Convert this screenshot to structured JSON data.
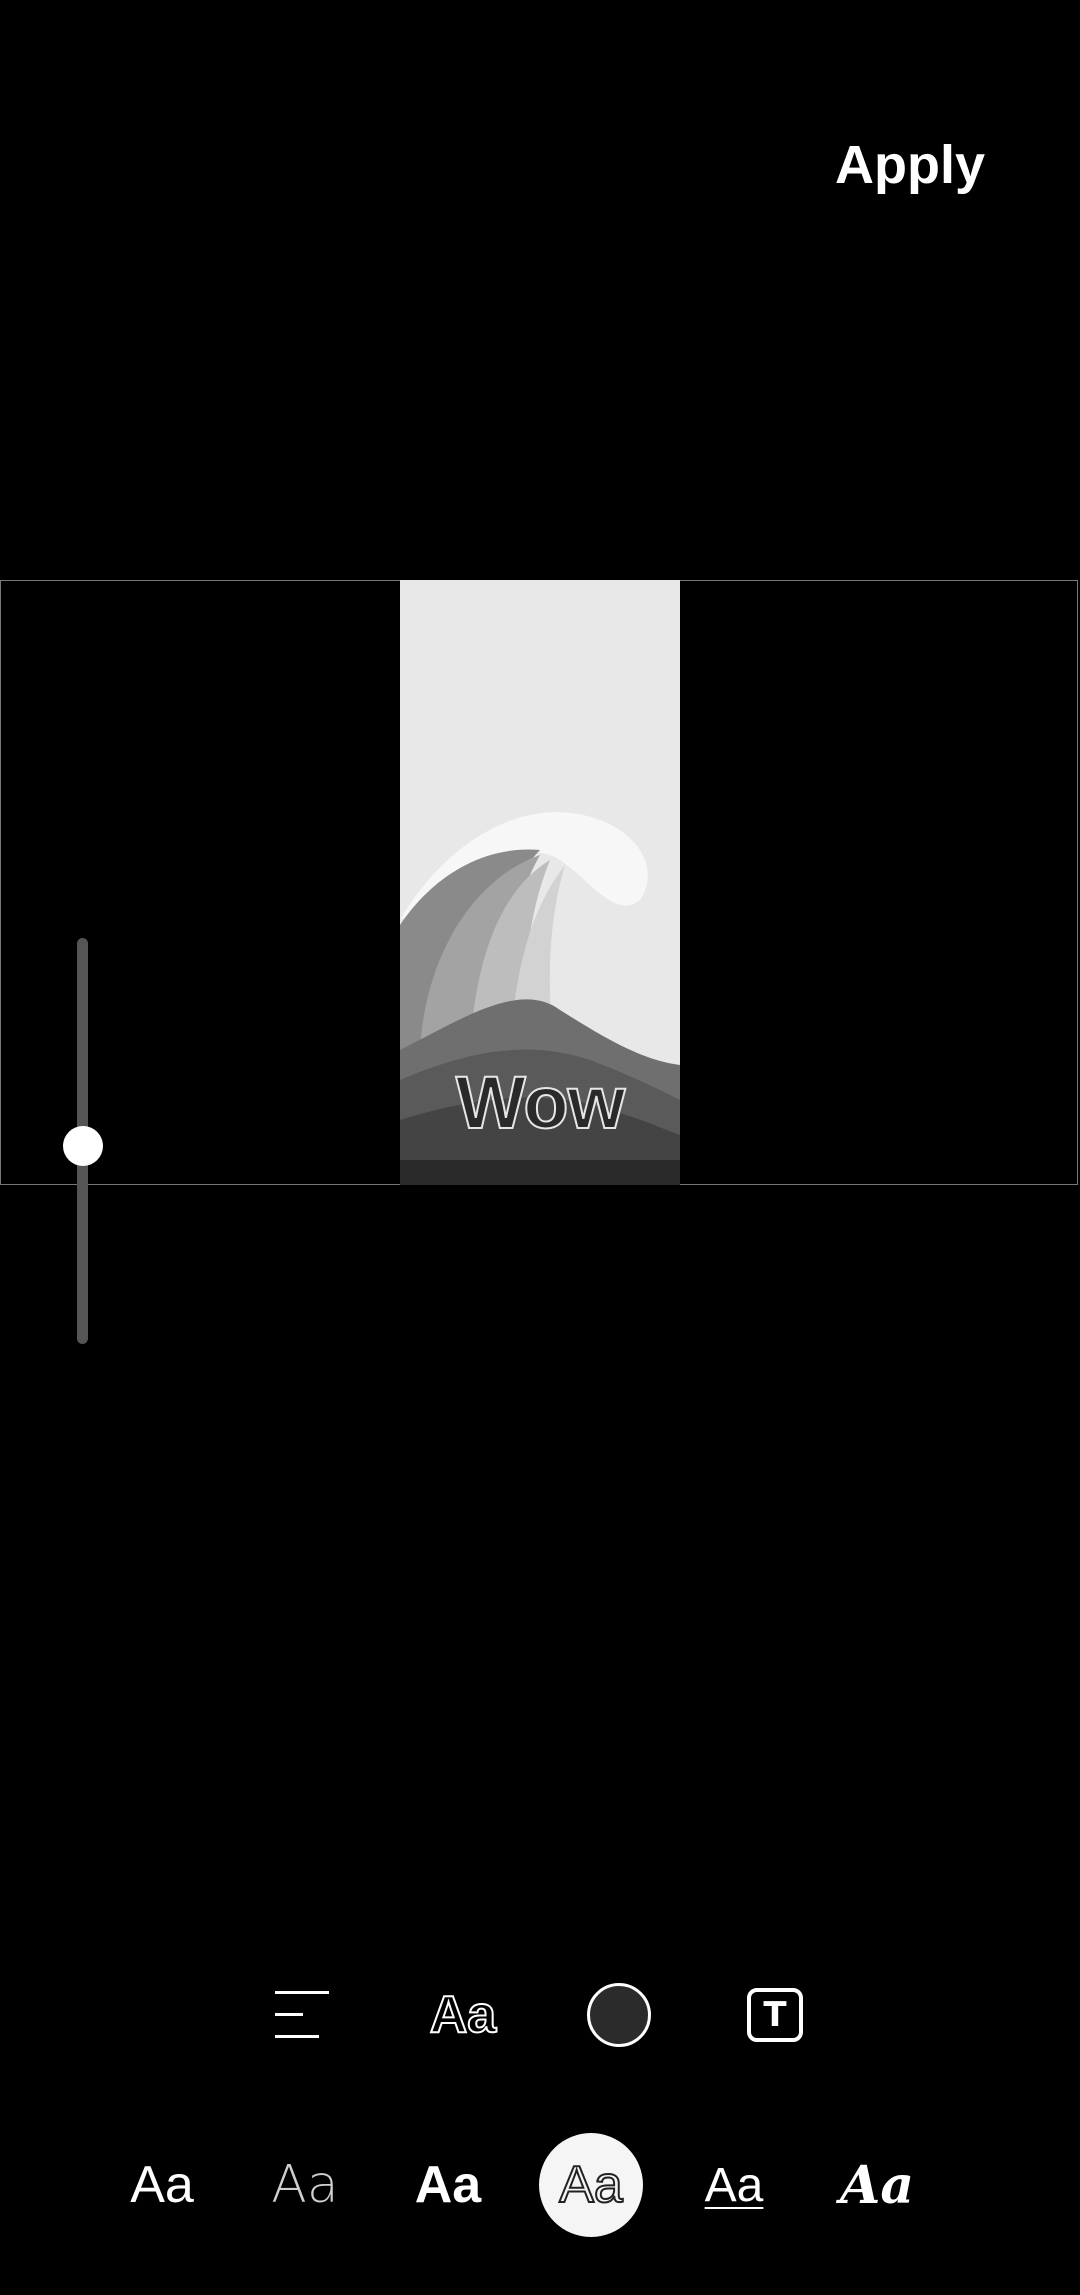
{
  "header": {
    "apply_label": "Apply"
  },
  "preview": {
    "overlay_text": "Wow"
  },
  "toolbar": {
    "tools": [
      {
        "icon": "align-left-icon"
      },
      {
        "icon": "text-outline-style-icon",
        "label": "Aa"
      },
      {
        "icon": "color-circle-icon",
        "color": "#2b2b2b"
      },
      {
        "icon": "text-background-icon",
        "label": "T"
      }
    ]
  },
  "font_styles": {
    "options": [
      {
        "label": "Aa",
        "style": "regular"
      },
      {
        "label": "Aa",
        "style": "thin"
      },
      {
        "label": "Aa",
        "style": "bold"
      },
      {
        "label": "Aa",
        "style": "outline",
        "selected": true
      },
      {
        "label": "Aa",
        "style": "underline-light"
      },
      {
        "label": "Aa",
        "style": "bold-italic-serif"
      }
    ]
  },
  "colors": {
    "background": "#000000",
    "accent": "#ffffff",
    "frame": "#777777"
  }
}
